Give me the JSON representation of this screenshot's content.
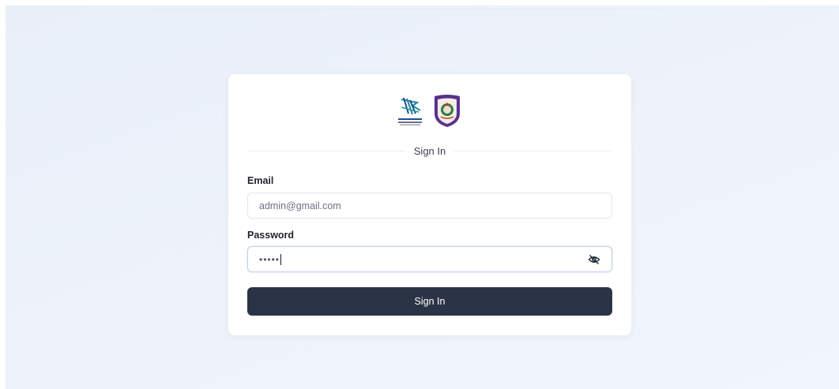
{
  "login": {
    "title": "Sign In",
    "email": {
      "label": "Email",
      "value": "admin@gmail.com"
    },
    "password": {
      "label": "Password",
      "masked_value": "•••••",
      "toggle_icon": "eye-off-icon"
    },
    "submit_label": "Sign In"
  },
  "logos": {
    "left": "partner-logo",
    "right": "crest-logo"
  },
  "colors": {
    "background": "#edf2fa",
    "card": "#ffffff",
    "button": "#2a3445",
    "button_text": "#ffffff",
    "logo_teal": "#1f8a98",
    "logo_blue": "#1f4c95",
    "crest_purple": "#5a3190"
  }
}
